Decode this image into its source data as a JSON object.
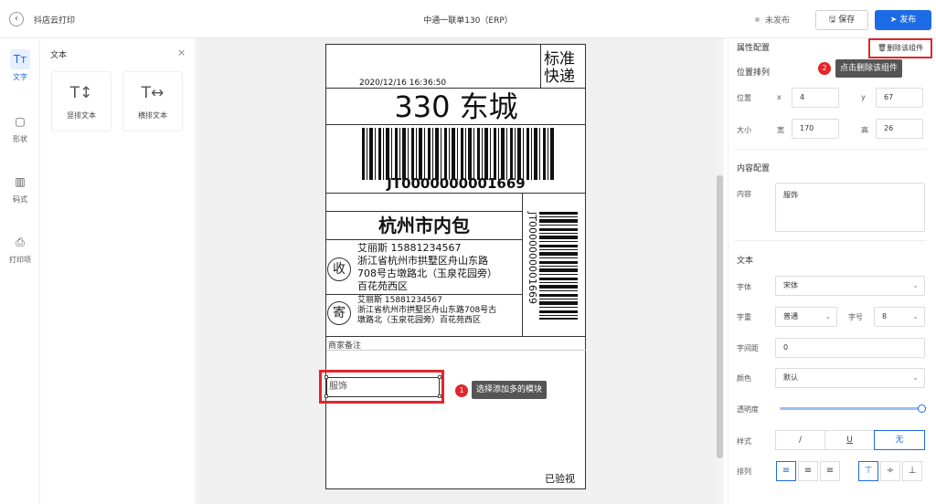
{
  "app": {
    "back_icon": "back-arrow-icon",
    "title": "抖店云打印"
  },
  "document": {
    "title": "中通一联单130（ERP）"
  },
  "header": {
    "status": "未发布",
    "save_label": "保存",
    "publish_label": "发布"
  },
  "leftnav": [
    {
      "label": "文字",
      "icon": "text-icon",
      "glyph": "Tт"
    },
    {
      "label": "形状",
      "icon": "shape-icon",
      "glyph": "▢"
    },
    {
      "label": "码式",
      "icon": "barcode-icon",
      "glyph": "▥"
    },
    {
      "label": "打印项",
      "icon": "printer-icon",
      "glyph": "⎙"
    }
  ],
  "panel": {
    "title": "文本",
    "widgets": [
      {
        "label": "竖排文本",
        "icon": "vertical-text-icon",
        "glyph": "T↕"
      },
      {
        "label": "横排文本",
        "icon": "horizontal-text-icon",
        "glyph": "T↔"
      }
    ]
  },
  "label": {
    "express_type": [
      "标准",
      "快递"
    ],
    "datetime": "2020/12/16  16:36:50",
    "route_code": "330  东城",
    "tracking_no": "JT0000000001669",
    "sort_center": "杭州市内包",
    "recv_char": "收",
    "receiver_name_phone": "艾丽斯  15881234567",
    "receiver_addr_1": "浙江省杭州市拱墅区舟山东路",
    "receiver_addr_2": "708号古墩路北（玉泉花园旁）",
    "receiver_addr_3": "百花苑西区",
    "send_char": "寄",
    "sender_name_phone": "艾丽斯  15881234567",
    "sender_addr_1": "浙江省杭州市拱墅区舟山东路708号古",
    "sender_addr_2": "墩路北（玉泉花园旁）百花苑西区",
    "remark_title": "商家备注",
    "selected_text": "服饰",
    "inspected": "已验视"
  },
  "annotations": {
    "step1_num": "1",
    "step1_text": "选择添加多的模块",
    "step2_num": "2",
    "step2_text": "点击删除该组件"
  },
  "properties": {
    "title": "属性配置",
    "delete_label": "删除该组件",
    "position_title": "位置排列",
    "pos_label": "位置",
    "x_label": "x",
    "x_value": "4",
    "y_label": "y",
    "y_value": "67",
    "size_label": "大小",
    "w_label": "宽",
    "w_value": "170",
    "h_label": "高",
    "h_value": "26",
    "content_title": "内容配置",
    "content_label": "内容",
    "content_value": "服饰",
    "text_title": "文本",
    "font_label": "字体",
    "font_value": "宋体",
    "weight_label": "字重",
    "weight_value": "普通",
    "size_font_label": "字号",
    "size_font_value": "8",
    "spacing_label": "字间距",
    "spacing_value": "0",
    "color_label": "颜色",
    "color_value": "默认",
    "opacity_label": "透明度",
    "opacity_value": 1.0,
    "style_label": "样式",
    "style_italic": "/",
    "style_underline": "U",
    "style_none": "无",
    "align_label": "排列"
  },
  "colors": {
    "accent": "#1e6be6",
    "annotation": "#e2262a"
  }
}
